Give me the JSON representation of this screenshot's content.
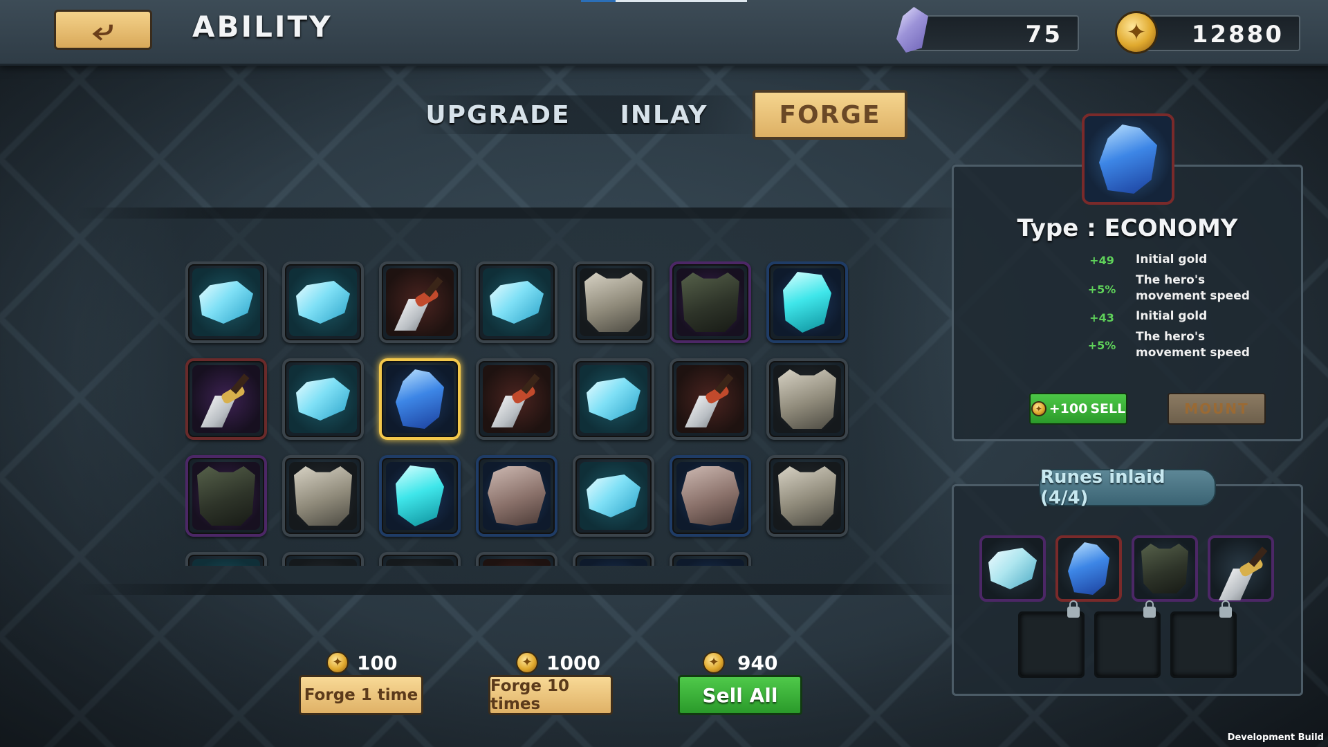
{
  "header": {
    "title": "ABILITY",
    "gems": "75",
    "gold": "12880",
    "back_icon": "back-arrow-icon"
  },
  "tabs": [
    {
      "label": "UPGRADE",
      "active": false
    },
    {
      "label": "INLAY",
      "active": false
    },
    {
      "label": "FORGE",
      "active": true
    }
  ],
  "inventory": {
    "rows": [
      [
        "ice-rock",
        "ice-rock",
        "dagger",
        "ice-rock",
        "armor",
        "dark-armor",
        "cyan-crystal"
      ],
      [
        "purple-dagger",
        "ice-rock",
        "blue-crystal",
        "dagger",
        "ice-rock",
        "dagger",
        "armor"
      ],
      [
        "dark-armor",
        "armor",
        "cyan-crystal",
        "plate-armor",
        "ice-rock",
        "plate-armor",
        "armor"
      ]
    ],
    "selected": [
      1,
      2
    ]
  },
  "forge": {
    "one": {
      "cost": "100",
      "label": "Forge 1 time"
    },
    "ten": {
      "cost": "1000",
      "label": "Forge 10 times"
    },
    "sell_all": {
      "cost": "940",
      "label": "Sell All"
    }
  },
  "detail": {
    "type_title": "Type : ECONOMY",
    "stats": [
      {
        "value": "+49",
        "text": "Initial gold"
      },
      {
        "value": "+5%",
        "text": "The hero's movement speed"
      },
      {
        "value": "+43",
        "text": "Initial gold"
      },
      {
        "value": "+5%",
        "text": "The hero's movement speed"
      }
    ],
    "sell_amount": "+100",
    "sell_label": "SELL",
    "mount_label": "MOUNT"
  },
  "runes": {
    "title": "Runes inlaid (4/4)",
    "items": [
      "ice-rock",
      "blue-crystal",
      "dark-armor",
      "golden-dagger"
    ]
  },
  "footer": {
    "dev_build": "Development Build"
  },
  "colors": {
    "accent_gold": "#f5d58f",
    "sell_green": "#3cb53a",
    "stat_green": "#5fd25a"
  }
}
